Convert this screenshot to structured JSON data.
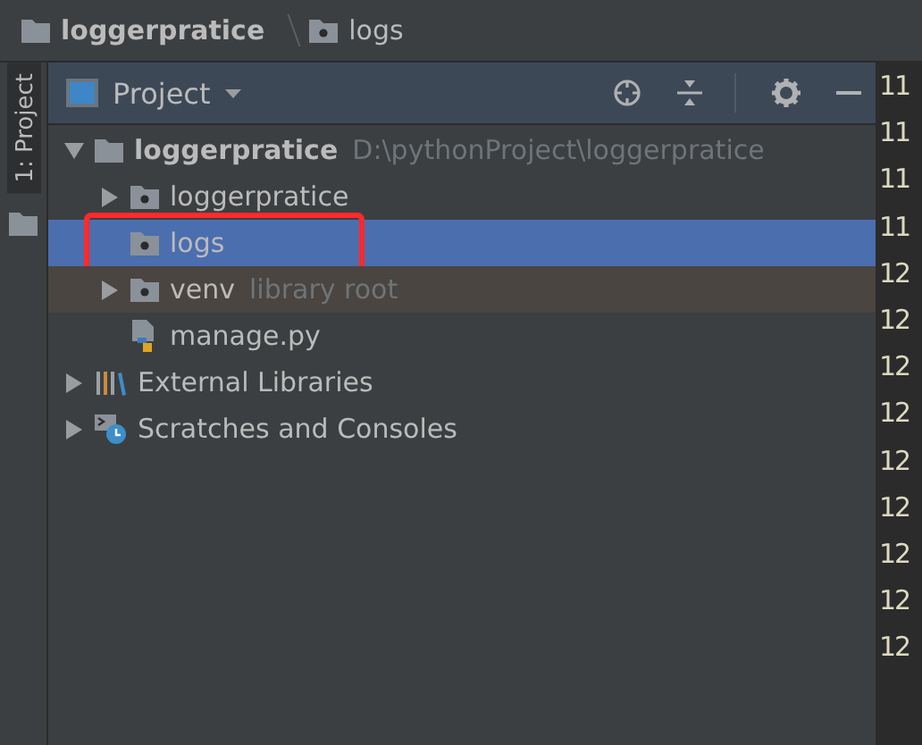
{
  "breadcrumb": [
    {
      "label": "loggerpratice",
      "kind": "module"
    },
    {
      "label": "logs",
      "kind": "source-folder"
    }
  ],
  "side_tabs": [
    {
      "label": "1: Project",
      "selected": true
    }
  ],
  "panel": {
    "title": "Project"
  },
  "tree": [
    {
      "label": "loggerpratice",
      "hint": "D:\\pythonProject\\loggerpratice",
      "kind": "module",
      "expanded": true,
      "selected": false,
      "highlighted": false,
      "children": [
        {
          "label": "loggerpratice",
          "kind": "source-folder",
          "expanded": false,
          "selected": false,
          "highlighted": false
        },
        {
          "label": "logs",
          "kind": "source-folder",
          "selected": true,
          "highlighted": false,
          "annotated": true
        },
        {
          "label": "venv",
          "hint": "library root",
          "kind": "source-folder",
          "expanded": false,
          "selected": false,
          "highlighted": true
        },
        {
          "label": "manage.py",
          "kind": "python-file",
          "selected": false,
          "highlighted": false
        }
      ]
    },
    {
      "label": "External Libraries",
      "kind": "libraries",
      "expanded": false,
      "selected": false,
      "highlighted": false
    },
    {
      "label": "Scratches and Consoles",
      "kind": "scratches",
      "expanded": false,
      "selected": false,
      "highlighted": false
    }
  ],
  "gutter": [
    "11",
    "11",
    "11",
    "11",
    "12",
    "12",
    "12",
    "12",
    "12",
    "12",
    "12",
    "12",
    "12"
  ]
}
